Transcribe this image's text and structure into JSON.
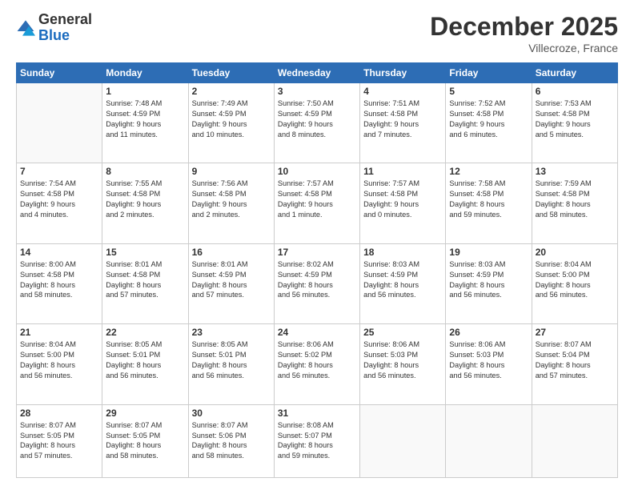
{
  "logo": {
    "line1": "General",
    "line2": "Blue"
  },
  "title": "December 2025",
  "location": "Villecroze, France",
  "days_header": [
    "Sunday",
    "Monday",
    "Tuesday",
    "Wednesday",
    "Thursday",
    "Friday",
    "Saturday"
  ],
  "weeks": [
    [
      {
        "day": "",
        "info": ""
      },
      {
        "day": "1",
        "info": "Sunrise: 7:48 AM\nSunset: 4:59 PM\nDaylight: 9 hours\nand 11 minutes."
      },
      {
        "day": "2",
        "info": "Sunrise: 7:49 AM\nSunset: 4:59 PM\nDaylight: 9 hours\nand 10 minutes."
      },
      {
        "day": "3",
        "info": "Sunrise: 7:50 AM\nSunset: 4:59 PM\nDaylight: 9 hours\nand 8 minutes."
      },
      {
        "day": "4",
        "info": "Sunrise: 7:51 AM\nSunset: 4:58 PM\nDaylight: 9 hours\nand 7 minutes."
      },
      {
        "day": "5",
        "info": "Sunrise: 7:52 AM\nSunset: 4:58 PM\nDaylight: 9 hours\nand 6 minutes."
      },
      {
        "day": "6",
        "info": "Sunrise: 7:53 AM\nSunset: 4:58 PM\nDaylight: 9 hours\nand 5 minutes."
      }
    ],
    [
      {
        "day": "7",
        "info": "Sunrise: 7:54 AM\nSunset: 4:58 PM\nDaylight: 9 hours\nand 4 minutes."
      },
      {
        "day": "8",
        "info": "Sunrise: 7:55 AM\nSunset: 4:58 PM\nDaylight: 9 hours\nand 2 minutes."
      },
      {
        "day": "9",
        "info": "Sunrise: 7:56 AM\nSunset: 4:58 PM\nDaylight: 9 hours\nand 2 minutes."
      },
      {
        "day": "10",
        "info": "Sunrise: 7:57 AM\nSunset: 4:58 PM\nDaylight: 9 hours\nand 1 minute."
      },
      {
        "day": "11",
        "info": "Sunrise: 7:57 AM\nSunset: 4:58 PM\nDaylight: 9 hours\nand 0 minutes."
      },
      {
        "day": "12",
        "info": "Sunrise: 7:58 AM\nSunset: 4:58 PM\nDaylight: 8 hours\nand 59 minutes."
      },
      {
        "day": "13",
        "info": "Sunrise: 7:59 AM\nSunset: 4:58 PM\nDaylight: 8 hours\nand 58 minutes."
      }
    ],
    [
      {
        "day": "14",
        "info": "Sunrise: 8:00 AM\nSunset: 4:58 PM\nDaylight: 8 hours\nand 58 minutes."
      },
      {
        "day": "15",
        "info": "Sunrise: 8:01 AM\nSunset: 4:58 PM\nDaylight: 8 hours\nand 57 minutes."
      },
      {
        "day": "16",
        "info": "Sunrise: 8:01 AM\nSunset: 4:59 PM\nDaylight: 8 hours\nand 57 minutes."
      },
      {
        "day": "17",
        "info": "Sunrise: 8:02 AM\nSunset: 4:59 PM\nDaylight: 8 hours\nand 56 minutes."
      },
      {
        "day": "18",
        "info": "Sunrise: 8:03 AM\nSunset: 4:59 PM\nDaylight: 8 hours\nand 56 minutes."
      },
      {
        "day": "19",
        "info": "Sunrise: 8:03 AM\nSunset: 4:59 PM\nDaylight: 8 hours\nand 56 minutes."
      },
      {
        "day": "20",
        "info": "Sunrise: 8:04 AM\nSunset: 5:00 PM\nDaylight: 8 hours\nand 56 minutes."
      }
    ],
    [
      {
        "day": "21",
        "info": "Sunrise: 8:04 AM\nSunset: 5:00 PM\nDaylight: 8 hours\nand 56 minutes."
      },
      {
        "day": "22",
        "info": "Sunrise: 8:05 AM\nSunset: 5:01 PM\nDaylight: 8 hours\nand 56 minutes."
      },
      {
        "day": "23",
        "info": "Sunrise: 8:05 AM\nSunset: 5:01 PM\nDaylight: 8 hours\nand 56 minutes."
      },
      {
        "day": "24",
        "info": "Sunrise: 8:06 AM\nSunset: 5:02 PM\nDaylight: 8 hours\nand 56 minutes."
      },
      {
        "day": "25",
        "info": "Sunrise: 8:06 AM\nSunset: 5:03 PM\nDaylight: 8 hours\nand 56 minutes."
      },
      {
        "day": "26",
        "info": "Sunrise: 8:06 AM\nSunset: 5:03 PM\nDaylight: 8 hours\nand 56 minutes."
      },
      {
        "day": "27",
        "info": "Sunrise: 8:07 AM\nSunset: 5:04 PM\nDaylight: 8 hours\nand 57 minutes."
      }
    ],
    [
      {
        "day": "28",
        "info": "Sunrise: 8:07 AM\nSunset: 5:05 PM\nDaylight: 8 hours\nand 57 minutes."
      },
      {
        "day": "29",
        "info": "Sunrise: 8:07 AM\nSunset: 5:05 PM\nDaylight: 8 hours\nand 58 minutes."
      },
      {
        "day": "30",
        "info": "Sunrise: 8:07 AM\nSunset: 5:06 PM\nDaylight: 8 hours\nand 58 minutes."
      },
      {
        "day": "31",
        "info": "Sunrise: 8:08 AM\nSunset: 5:07 PM\nDaylight: 8 hours\nand 59 minutes."
      },
      {
        "day": "",
        "info": ""
      },
      {
        "day": "",
        "info": ""
      },
      {
        "day": "",
        "info": ""
      }
    ]
  ]
}
